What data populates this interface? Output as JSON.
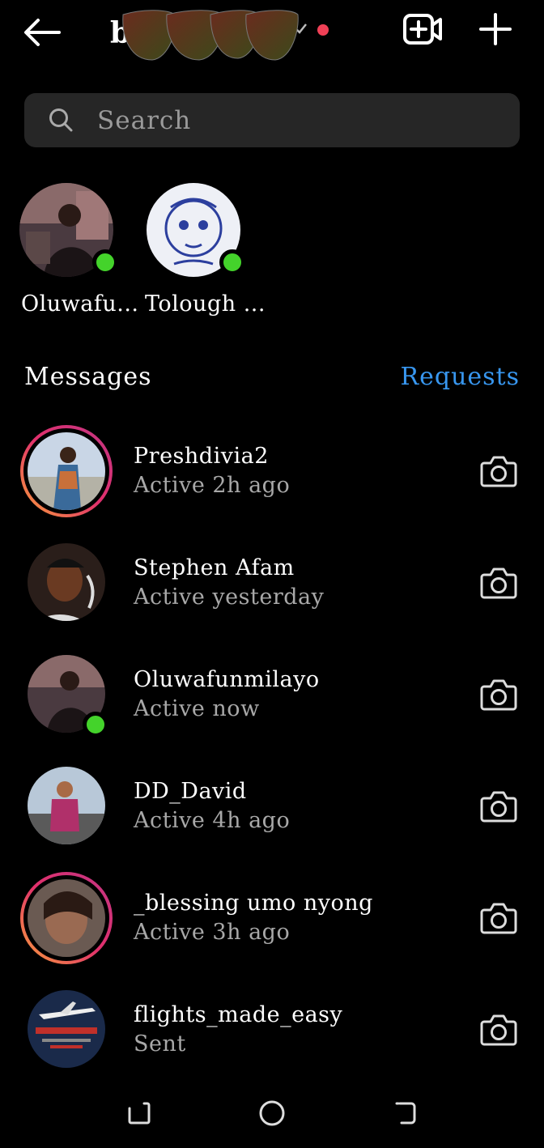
{
  "header": {
    "title": "b",
    "back_icon": "arrow-left-icon",
    "new_video_icon": "video-plus-icon",
    "new_message_icon": "plus-icon",
    "status_dot_color": "#ef4056"
  },
  "search": {
    "placeholder": "Search",
    "value": ""
  },
  "active_users": [
    {
      "name": "Oluwafu..."
    },
    {
      "name": "Tolough ..."
    }
  ],
  "messages_section": {
    "title": "Messages",
    "requests_label": "Requests"
  },
  "threads": [
    {
      "username": "Preshdivia2",
      "status": "Active 2h ago",
      "story_ring": true,
      "online": false
    },
    {
      "username": "Stephen Afam",
      "status": "Active yesterday",
      "story_ring": false,
      "online": false
    },
    {
      "username": "Oluwafunmilayo",
      "status": "Active now",
      "story_ring": false,
      "online": true
    },
    {
      "username": "DD_David",
      "status": "Active 4h ago",
      "story_ring": false,
      "online": false
    },
    {
      "username": "_blessing umo nyong",
      "status": "Active 3h ago",
      "story_ring": true,
      "online": false
    },
    {
      "username": "flights_made_easy",
      "status": "Sent",
      "story_ring": false,
      "online": false
    }
  ],
  "colors": {
    "background": "#000000",
    "search_bg": "#262626",
    "accent_blue": "#3897f0",
    "online_green": "#44d32b",
    "secondary_text": "#a8a8a8"
  },
  "system_nav": {
    "recents_icon": "recents-icon",
    "home_icon": "home-circle-icon",
    "back_icon": "system-back-icon"
  }
}
